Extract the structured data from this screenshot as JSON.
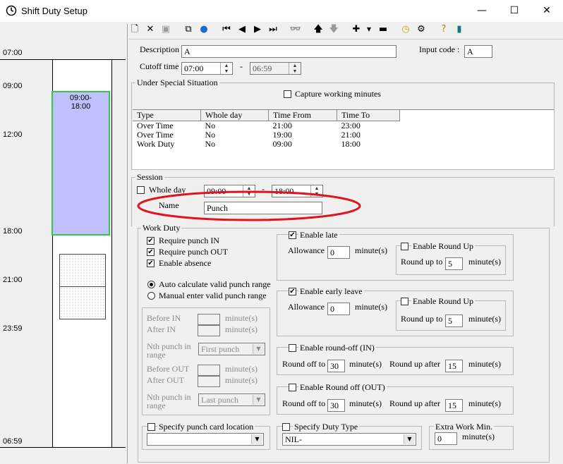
{
  "window": {
    "title": "Shift Duty Setup",
    "minimize": "—",
    "maximize": "☐",
    "close": "✕"
  },
  "timeline": {
    "labels": [
      "07:00",
      "09:00",
      "12:00",
      "18:00",
      "21:00",
      "23:59",
      "06:59"
    ],
    "block_start": "09:00-",
    "block_end": "18:00"
  },
  "toolbar": [
    "new",
    "delete",
    "save",
    "copy",
    "globe",
    "first",
    "previous",
    "next",
    "last",
    "find",
    "move-up",
    "move-down",
    "add",
    "remove",
    "clock",
    "options",
    "help",
    "exit"
  ],
  "form": {
    "description_label": "Description",
    "description_value": "A",
    "input_code_label": "Input code :",
    "input_code_value": "A",
    "cutoff_label": "Cutoff time",
    "cutoff_from": "07:00",
    "cutoff_sep": "-",
    "cutoff_to": "06:59"
  },
  "special": {
    "group_label": "Under Special Situation",
    "capture_label": "Capture working minutes",
    "columns": [
      "Type",
      "Whole day",
      "Time From",
      "Time To"
    ],
    "rows": [
      [
        "Over Time",
        "No",
        "21:00",
        "23:00"
      ],
      [
        "Over Time",
        "No",
        "19:00",
        "21:00"
      ],
      [
        "Work Duty",
        "No",
        "09:00",
        "18:00"
      ]
    ]
  },
  "session": {
    "group_label": "Session",
    "whole_day_label": "Whole day",
    "from": "09:00",
    "sep": "-",
    "to": "18:00",
    "name_label": "Name",
    "name_value": "Punch"
  },
  "work_duty": {
    "group_label": "Work Duty",
    "require_in": "Require punch IN",
    "require_out": "Require punch OUT",
    "enable_absence": "Enable absence",
    "auto_calc": "Auto calculate valid punch range",
    "manual_enter": "Manual enter valid punch range",
    "before_in": "Before IN",
    "after_in": "After IN",
    "nth_in_1": "Nth punch in",
    "nth_in_2": "range",
    "first_punch": "First punch",
    "before_out": "Before OUT",
    "after_out": "After OUT",
    "nth_out_1": "Nth punch in",
    "nth_out_2": "range",
    "last_punch": "Last punch",
    "minutes": "minute(s)",
    "enable_late": "Enable late",
    "late_allowance_label": "Allowance",
    "late_allowance": "0",
    "late_roundup": "Enable Round Up",
    "late_roundup_to_label": "Round up to",
    "late_roundup_to": "5",
    "enable_early": "Enable early leave",
    "early_allowance_label": "Allowance",
    "early_allowance": "0",
    "early_roundup": "Enable Round Up",
    "early_roundup_to_label": "Round up to",
    "early_roundup_to": "5",
    "roundoff_in": "Enable round-off (IN)",
    "roundoff_in_off_label": "Round off to",
    "roundoff_in_off": "30",
    "roundoff_in_after_label": "Round up after",
    "roundoff_in_after": "15",
    "roundoff_out": "Enable Round off (OUT)",
    "roundoff_out_off_label": "Round off to",
    "roundoff_out_off": "30",
    "roundoff_out_after_label": "Round up after",
    "roundoff_out_after": "15",
    "punch_card_label": "Specify punch card location",
    "duty_type_label": "Specify Duty Type",
    "duty_type_value": "NIL-",
    "extra_work_label": "Extra Work Min.",
    "extra_work_value": "0"
  }
}
